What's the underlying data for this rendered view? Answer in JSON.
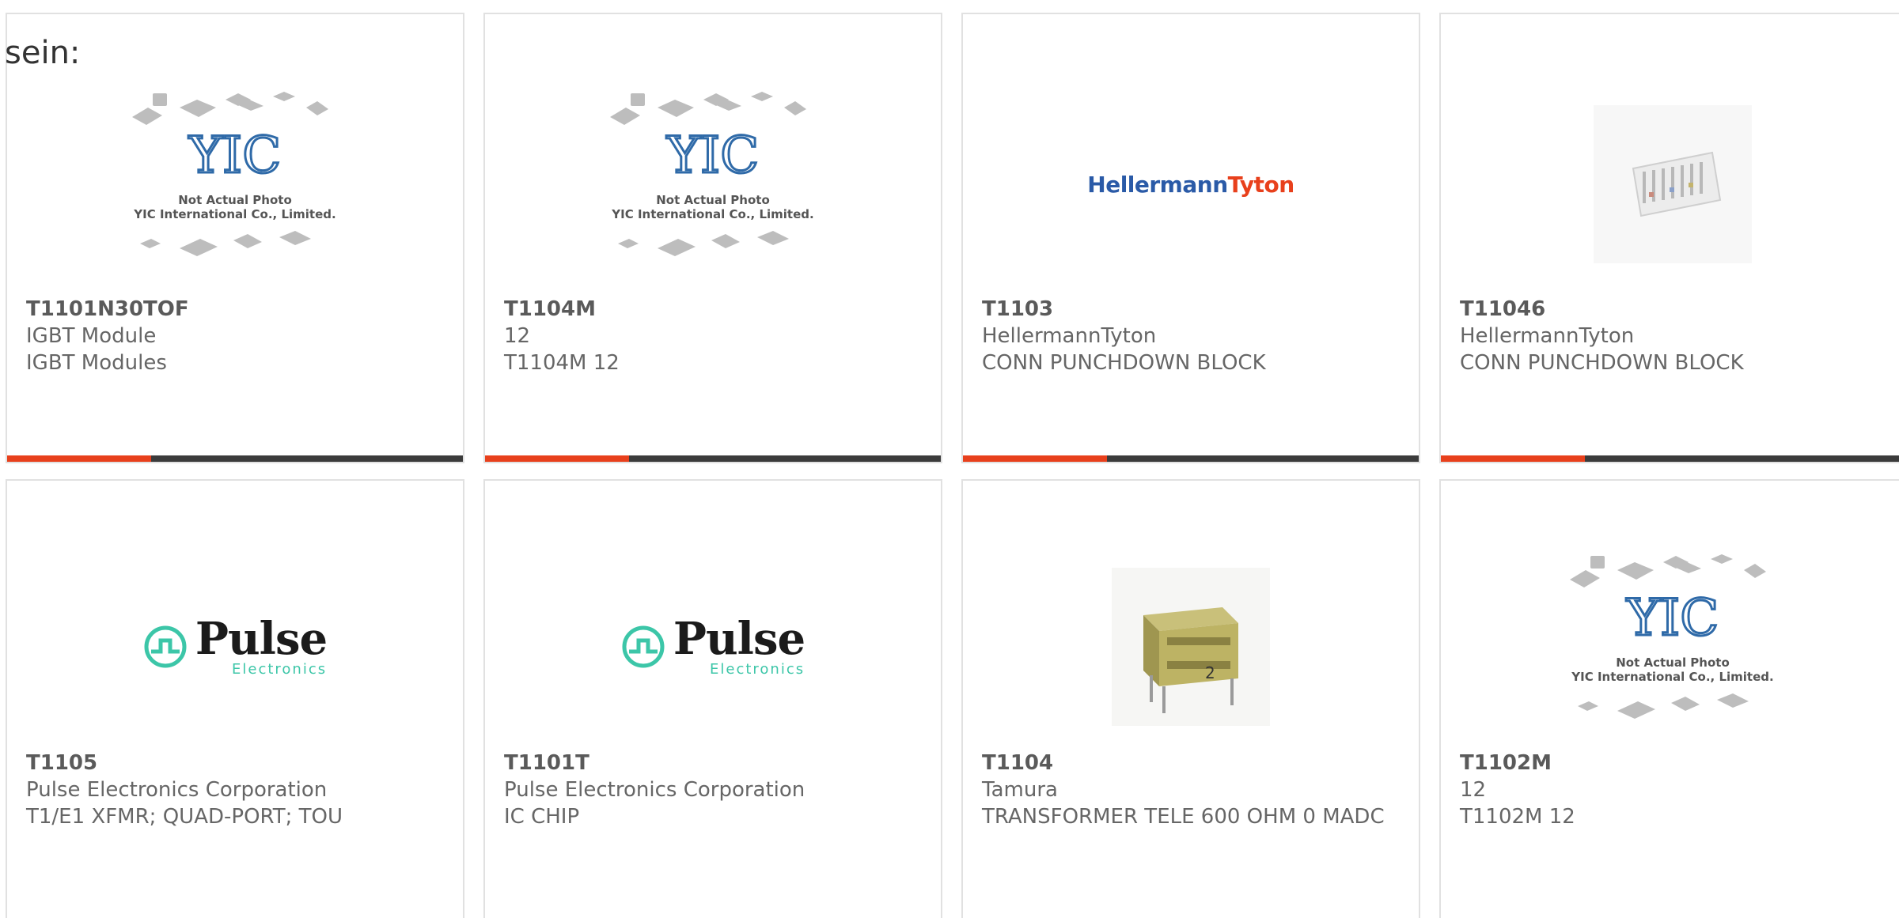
{
  "intro_text": "sein:",
  "accent_color": "#e8401c",
  "bar_color": "#3b3b3b",
  "products": [
    {
      "part": "T1101N30TOF",
      "line1": "IGBT Module",
      "line2": "IGBT Modules",
      "image": "yic-placeholder-photo"
    },
    {
      "part": "T1104M",
      "line1": "12",
      "line2": "T1104M 12",
      "image": "yic-placeholder-photo"
    },
    {
      "part": "T1103",
      "line1": "HellermannTyton",
      "line2": "CONN PUNCHDOWN BLOCK",
      "image": "hellermanntyton-logo"
    },
    {
      "part": "T11046",
      "line1": "HellermannTyton",
      "line2": "CONN PUNCHDOWN BLOCK",
      "image": "punchdown-block-photo"
    },
    {
      "part": "T1105",
      "line1": "Pulse Electronics Corporation",
      "line2": "T1/E1 XFMR; QUAD-PORT; TOU",
      "image": "pulse-electronics-logo"
    },
    {
      "part": "T1101T",
      "line1": "Pulse Electronics Corporation",
      "line2": "IC CHIP",
      "image": "pulse-electronics-logo"
    },
    {
      "part": "T1104",
      "line1": "Tamura",
      "line2": "TRANSFORMER TELE 600 OHM 0 MADC",
      "image": "transformer-photo"
    },
    {
      "part": "T1102M",
      "line1": "12",
      "line2": "T1102M 12",
      "image": "yic-placeholder-photo"
    }
  ],
  "yic": {
    "caption1": "Not Actual Photo",
    "caption2": "YIC International Co., Limited.",
    "logo": "YIC"
  },
  "hellermann": {
    "part_a": "Hellermann",
    "part_b": "Tyton"
  },
  "pulse": {
    "name": "Pulse",
    "sub": "Electronics"
  }
}
